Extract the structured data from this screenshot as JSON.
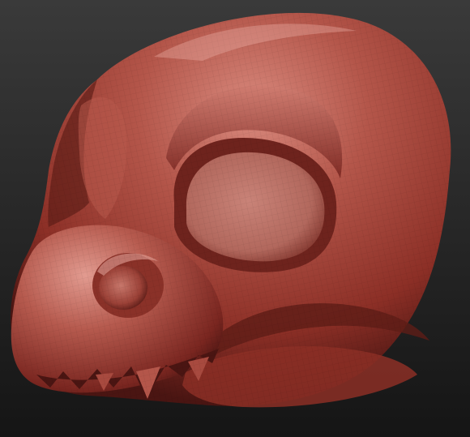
{
  "viewport": {
    "background_top": "#3a3a3a",
    "background_bottom": "#151515"
  },
  "model": {
    "material_color": "#a8443a",
    "material_highlight": "#d98a7e",
    "material_shadow": "#4a1512",
    "wireframe_visible": true
  }
}
